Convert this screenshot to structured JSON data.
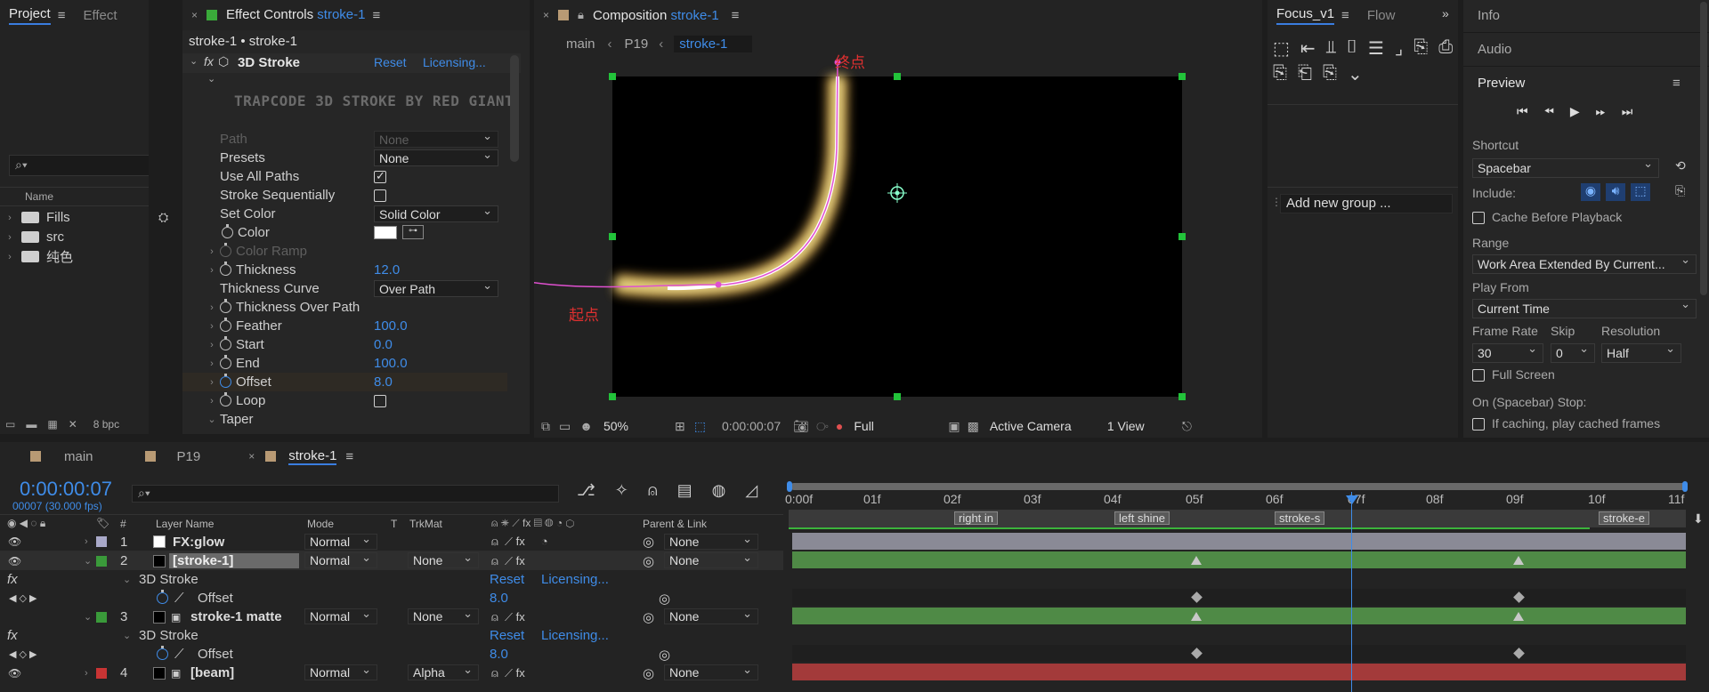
{
  "project": {
    "tabs": [
      "Project",
      "Effect"
    ],
    "col_name": "Name",
    "items": [
      "Fills",
      "src",
      "纯色"
    ],
    "footer_bpc": "8 bpc"
  },
  "effect_controls": {
    "tab_label": "Effect Controls",
    "tab_comp": "stroke-1",
    "breadcrumb": "stroke-1 • stroke-1",
    "effect_name": "3D Stroke",
    "reset": "Reset",
    "licensing": "Licensing...",
    "banner": "TRAPCODE 3D STROKE BY RED GIANT",
    "props": {
      "path": "Path",
      "path_val": "None",
      "presets": "Presets",
      "presets_val": "None",
      "use_all_paths": "Use All Paths",
      "stroke_seq": "Stroke Sequentially",
      "set_color": "Set Color",
      "set_color_val": "Solid Color",
      "color": "Color",
      "color_ramp": "Color Ramp",
      "thickness": "Thickness",
      "thickness_val": "12.0",
      "thickness_curve": "Thickness Curve",
      "thickness_curve_val": "Over Path",
      "thickness_over_path": "Thickness Over Path",
      "feather": "Feather",
      "feather_val": "100.0",
      "start": "Start",
      "start_val": "0.0",
      "end": "End",
      "end_val": "100.0",
      "offset": "Offset",
      "offset_val": "8.0",
      "loop": "Loop",
      "taper": "Taper"
    }
  },
  "composition": {
    "tab_label": "Composition",
    "tab_comp": "stroke-1",
    "crumbs": [
      "main",
      "P19",
      "stroke-1"
    ],
    "label_end": "终点",
    "label_start": "起点",
    "zoom": "50%",
    "timecode": "0:00:00:07",
    "resolution": "Full",
    "camera": "Active Camera",
    "views": "1 View"
  },
  "focus": {
    "tabs": [
      "Focus_v1",
      "Flow"
    ],
    "add_group": "Add new group ..."
  },
  "right": {
    "info": "Info",
    "audio": "Audio",
    "preview": "Preview",
    "shortcut_label": "Shortcut",
    "shortcut_val": "Spacebar",
    "include_label": "Include:",
    "cache_before": "Cache Before Playback",
    "range_label": "Range",
    "range_val": "Work Area Extended By Current...",
    "play_from_label": "Play From",
    "play_from_val": "Current Time",
    "frame_rate_label": "Frame Rate",
    "skip_label": "Skip",
    "resolution_label": "Resolution",
    "frame_rate_val": "30",
    "skip_val": "0",
    "resolution_val": "Half",
    "full_screen": "Full Screen",
    "stop_label": "On (Spacebar) Stop:",
    "if_caching": "If caching, play cached frames"
  },
  "timeline": {
    "tabs": [
      "main",
      "P19",
      "stroke-1"
    ],
    "timecode": "0:00:00:07",
    "frame_info": "00007 (30.000 fps)",
    "col_layer_name": "Layer Name",
    "col_mode": "Mode",
    "col_t": "T",
    "col_trkmat": "TrkMat",
    "col_parent": "Parent & Link",
    "col_hash": "#",
    "ruler": [
      "0:00f",
      "01f",
      "02f",
      "03f",
      "04f",
      "05f",
      "06f",
      "07f",
      "08f",
      "09f",
      "10f",
      "11f"
    ],
    "markers": [
      "right in",
      "left shine",
      "stroke-s",
      "stroke-e"
    ],
    "layers": [
      {
        "num": "1",
        "name": "FX:glow",
        "mode": "Normal",
        "trkmat": "",
        "parent": "None",
        "color": "#a9a9c9"
      },
      {
        "num": "2",
        "name": "[stroke-1]",
        "mode": "Normal",
        "trkmat": "None",
        "parent": "None",
        "color": "#3a9a3a"
      },
      {
        "num": "3",
        "name": "stroke-1 matte",
        "mode": "Normal",
        "trkmat": "None",
        "parent": "None",
        "color": "#3a9a3a"
      },
      {
        "num": "4",
        "name": "[beam]",
        "mode": "Normal",
        "trkmat": "Alpha",
        "parent": "None",
        "color": "#c83434"
      }
    ],
    "effect_name": "3D Stroke",
    "reset": "Reset",
    "licensing": "Licensing...",
    "offset_label": "Offset",
    "offset_val": "8.0"
  },
  "colors": {
    "accent": "#3f8ce8",
    "green_bar": "#4f8a46",
    "red_bar": "#a33a3a",
    "label_red": "#e03030"
  }
}
